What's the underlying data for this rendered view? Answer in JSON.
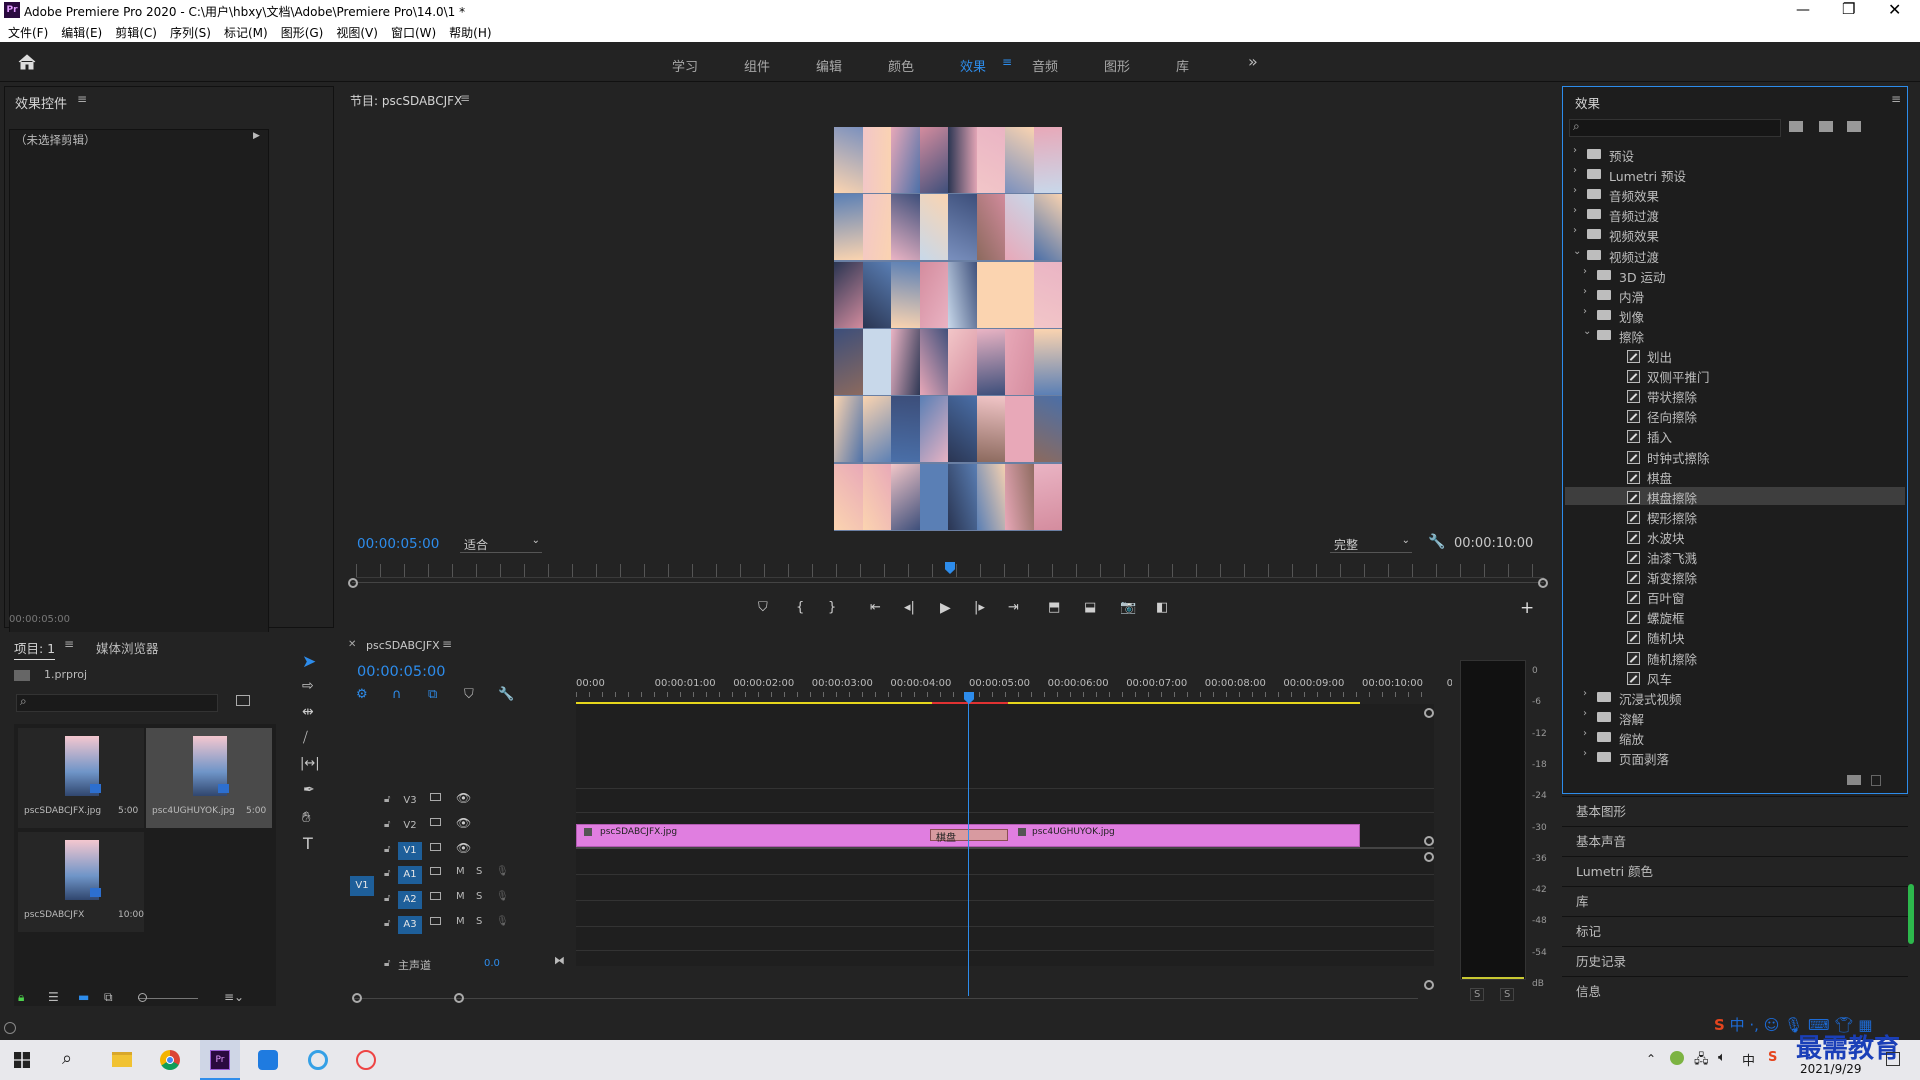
{
  "window": {
    "app_icon": "Pr",
    "title": "Adobe Premiere Pro 2020 - C:\\用户\\hbxy\\文档\\Adobe\\Premiere Pro\\14.0\\1 *"
  },
  "menu": [
    "文件(F)",
    "编辑(E)",
    "剪辑(C)",
    "序列(S)",
    "标记(M)",
    "图形(G)",
    "视图(V)",
    "窗口(W)",
    "帮助(H)"
  ],
  "workspaces": [
    "学习",
    "组件",
    "编辑",
    "颜色",
    "效果",
    "音频",
    "图形",
    "库"
  ],
  "active_workspace": "效果",
  "effect_controls": {
    "title": "效果控件",
    "no_clip": "（未选择剪辑）",
    "timecode": "00:00:05:00"
  },
  "program": {
    "title": "节目: pscSDABCJFX",
    "timecode_left": "00:00:05:00",
    "fit": "适合",
    "quality": "完整",
    "timecode_right": "00:00:10:00",
    "playhead_fraction": 0.5
  },
  "project": {
    "tab1": "项目: 1",
    "tab2": "媒体浏览器",
    "file": "1.prproj",
    "items": [
      {
        "name": "pscSDABCJFX.jpg",
        "dur": "5:00"
      },
      {
        "name": "psc4UGHUYOK.jpg",
        "dur": "5:00"
      },
      {
        "name": "pscSDABCJFX",
        "dur": "10:00"
      }
    ]
  },
  "timeline": {
    "tab": "pscSDABCJFX",
    "timecode": "00:00:05:00",
    "ruler": [
      "00:00",
      "00:00:01:00",
      "00:00:02:00",
      "00:00:03:00",
      "00:00:04:00",
      "00:00:05:00",
      "00:00:06:00",
      "00:00:07:00",
      "00:00:08:00",
      "00:00:09:00",
      "00:00:10:00",
      "0"
    ],
    "tracks_video": [
      "V3",
      "V2",
      "V1"
    ],
    "tracks_audio": [
      "A1",
      "A2",
      "A3"
    ],
    "source_patch": "V1",
    "mute": "M",
    "solo": "S",
    "master": "主声道",
    "master_val": "0.0",
    "clip1": "pscSDABCJFX.jpg",
    "clip2": "psc4UGHUYOK.jpg",
    "transition": "棋盘"
  },
  "meter": {
    "scale": [
      "0",
      "-6",
      "-12",
      "-18",
      "-24",
      "-30",
      "-36",
      "-42",
      "-48",
      "-54",
      "dB"
    ],
    "solo_left": "S",
    "solo_right": "S"
  },
  "effects": {
    "title": "效果",
    "tree": [
      {
        "lvl": 0,
        "t": "预设",
        "k": "folder-special",
        "open": false
      },
      {
        "lvl": 0,
        "t": "Lumetri 预设",
        "k": "folder-special",
        "open": false
      },
      {
        "lvl": 0,
        "t": "音频效果",
        "k": "folder",
        "open": false
      },
      {
        "lvl": 0,
        "t": "音频过渡",
        "k": "folder",
        "open": false
      },
      {
        "lvl": 0,
        "t": "视频效果",
        "k": "folder",
        "open": false
      },
      {
        "lvl": 0,
        "t": "视频过渡",
        "k": "folder",
        "open": true
      },
      {
        "lvl": 1,
        "t": "3D 运动",
        "k": "folder",
        "open": false
      },
      {
        "lvl": 1,
        "t": "内滑",
        "k": "folder",
        "open": false
      },
      {
        "lvl": 1,
        "t": "划像",
        "k": "folder",
        "open": false
      },
      {
        "lvl": 1,
        "t": "擦除",
        "k": "folder",
        "open": true
      },
      {
        "lvl": 2,
        "t": "划出",
        "k": "fx"
      },
      {
        "lvl": 2,
        "t": "双侧平推门",
        "k": "fx"
      },
      {
        "lvl": 2,
        "t": "带状擦除",
        "k": "fx"
      },
      {
        "lvl": 2,
        "t": "径向擦除",
        "k": "fx"
      },
      {
        "lvl": 2,
        "t": "插入",
        "k": "fx"
      },
      {
        "lvl": 2,
        "t": "时钟式擦除",
        "k": "fx"
      },
      {
        "lvl": 2,
        "t": "棋盘",
        "k": "fx"
      },
      {
        "lvl": 2,
        "t": "棋盘擦除",
        "k": "fx",
        "sel": true
      },
      {
        "lvl": 2,
        "t": "楔形擦除",
        "k": "fx"
      },
      {
        "lvl": 2,
        "t": "水波块",
        "k": "fx"
      },
      {
        "lvl": 2,
        "t": "油漆飞溅",
        "k": "fx"
      },
      {
        "lvl": 2,
        "t": "渐变擦除",
        "k": "fx"
      },
      {
        "lvl": 2,
        "t": "百叶窗",
        "k": "fx"
      },
      {
        "lvl": 2,
        "t": "螺旋框",
        "k": "fx"
      },
      {
        "lvl": 2,
        "t": "随机块",
        "k": "fx"
      },
      {
        "lvl": 2,
        "t": "随机擦除",
        "k": "fx"
      },
      {
        "lvl": 2,
        "t": "风车",
        "k": "fx"
      },
      {
        "lvl": 1,
        "t": "沉浸式视频",
        "k": "folder",
        "open": false
      },
      {
        "lvl": 1,
        "t": "溶解",
        "k": "folder",
        "open": false
      },
      {
        "lvl": 1,
        "t": "缩放",
        "k": "folder",
        "open": false
      },
      {
        "lvl": 1,
        "t": "页面剥落",
        "k": "folder",
        "open": false
      }
    ]
  },
  "side_panels": [
    "基本图形",
    "基本声音",
    "Lumetri 颜色",
    "库",
    "标记",
    "历史记录",
    "信息"
  ],
  "tray": {
    "date": "2021/9/29",
    "watermark": "最需教育",
    "ime": "中"
  },
  "colors": {
    "accent": "#2d8ceb",
    "clip": "#e07ee0",
    "transition": "#d89aa0"
  }
}
